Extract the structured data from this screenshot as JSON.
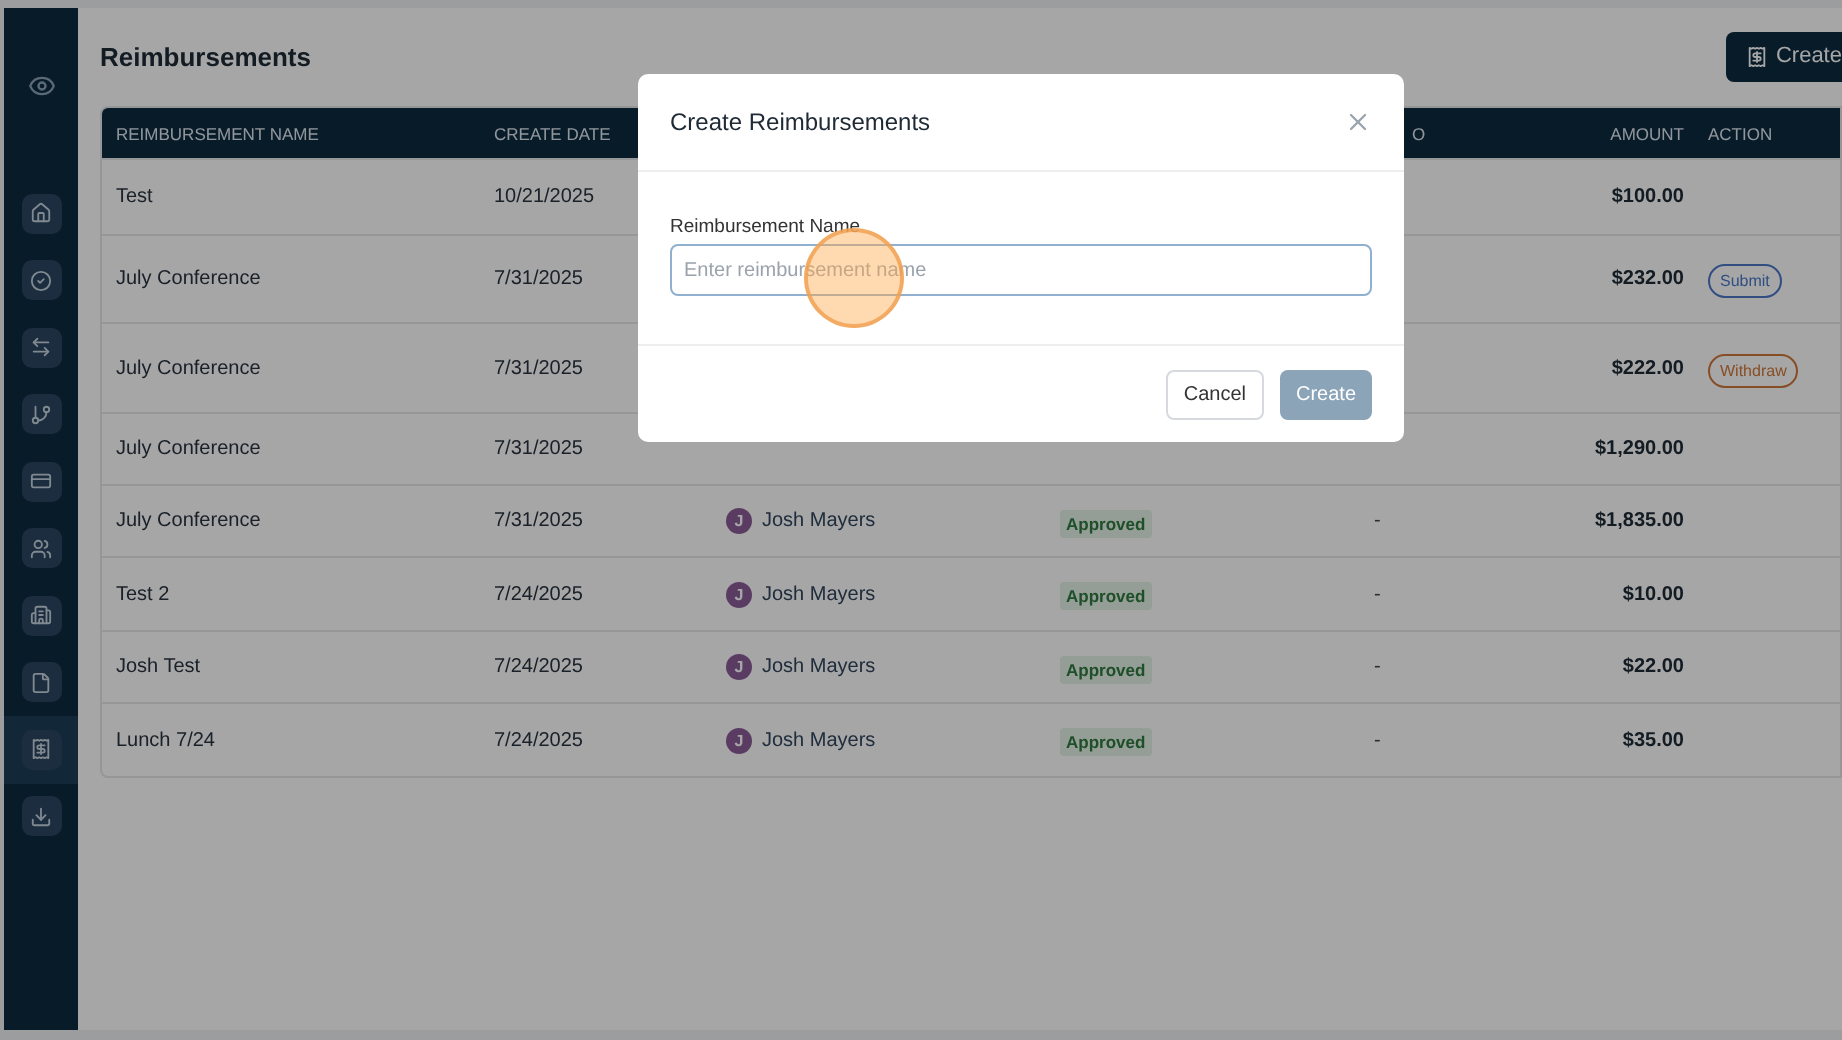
{
  "sidebar": {
    "items": [
      {
        "selected": false
      },
      {
        "selected": false
      },
      {
        "selected": false
      },
      {
        "selected": false
      },
      {
        "selected": false
      },
      {
        "selected": false
      },
      {
        "selected": false
      },
      {
        "selected": false
      },
      {
        "selected": true
      },
      {
        "selected": false
      }
    ]
  },
  "page": {
    "title": "Reimbursements",
    "create_button": "Create"
  },
  "table": {
    "columns": [
      {
        "label": "REIMBURSEMENT NAME"
      },
      {
        "label": "CREATE DATE"
      },
      {},
      {},
      {
        "label": "O"
      },
      {
        "label": "AMOUNT"
      },
      {
        "label": "ACTION"
      }
    ],
    "rows": [
      {
        "name": "Test",
        "date": "10/21/2025",
        "amount": "$100.00"
      },
      {
        "name": "July Conference",
        "date": "7/31/2025",
        "amount": "$232.00",
        "action": {
          "kind": "submit",
          "label": "Submit"
        }
      },
      {
        "name": "July Conference",
        "date": "7/31/2025",
        "amount": "$222.00",
        "action": {
          "kind": "withdraw",
          "label": "Withdraw"
        }
      },
      {
        "name": "July Conference",
        "date": "7/31/2025",
        "amount": "$1,290.00"
      },
      {
        "name": "July Conference",
        "date": "7/31/2025",
        "employee": {
          "initial": "J",
          "name": "Josh Mayers"
        },
        "status": "Approved",
        "column_5": "-",
        "amount": "$1,835.00"
      },
      {
        "name": "Test 2",
        "date": "7/24/2025",
        "employee": {
          "initial": "J",
          "name": "Josh Mayers"
        },
        "status": "Approved",
        "column_5": "-",
        "amount": "$10.00"
      },
      {
        "name": "Josh Test",
        "date": "7/24/2025",
        "employee": {
          "initial": "J",
          "name": "Josh Mayers"
        },
        "status": "Approved",
        "column_5": "-",
        "amount": "$22.00"
      },
      {
        "name": "Lunch 7/24",
        "date": "7/24/2025",
        "employee": {
          "initial": "J",
          "name": "Josh Mayers"
        },
        "status": "Approved",
        "column_5": "-",
        "amount": "$35.00"
      }
    ]
  },
  "modal": {
    "title": "Create Reimbursements",
    "field": {
      "label": "Reimbursement Name",
      "placeholder": "Enter reimbursement name"
    },
    "buttons": [
      {
        "kind": "cancel",
        "label": "Cancel"
      },
      {
        "kind": "create",
        "label": "Create",
        "disabled": true
      }
    ]
  }
}
